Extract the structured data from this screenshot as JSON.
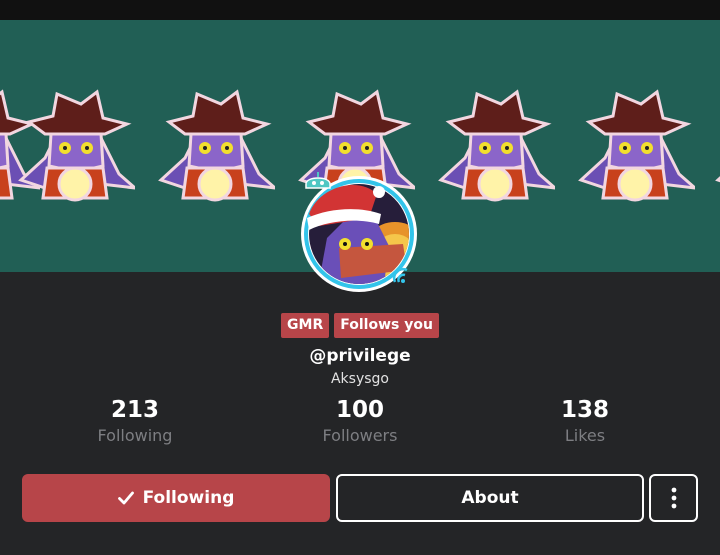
{
  "profile": {
    "badges": [
      "GMR",
      "Follows you"
    ],
    "handle": "@privilege",
    "display_name": "Aksysgo"
  },
  "stats": [
    {
      "value": "213",
      "label": "Following"
    },
    {
      "value": "100",
      "label": "Followers"
    },
    {
      "value": "138",
      "label": "Likes"
    }
  ],
  "actions": {
    "following_label": "Following",
    "following_icon": "check-icon",
    "about_label": "About",
    "more_icon": "kebab-menu-icon"
  },
  "colors": {
    "banner": "#215f55",
    "accent": "#b74549",
    "background": "#242527",
    "avatar_ring": "#33c4ea"
  }
}
